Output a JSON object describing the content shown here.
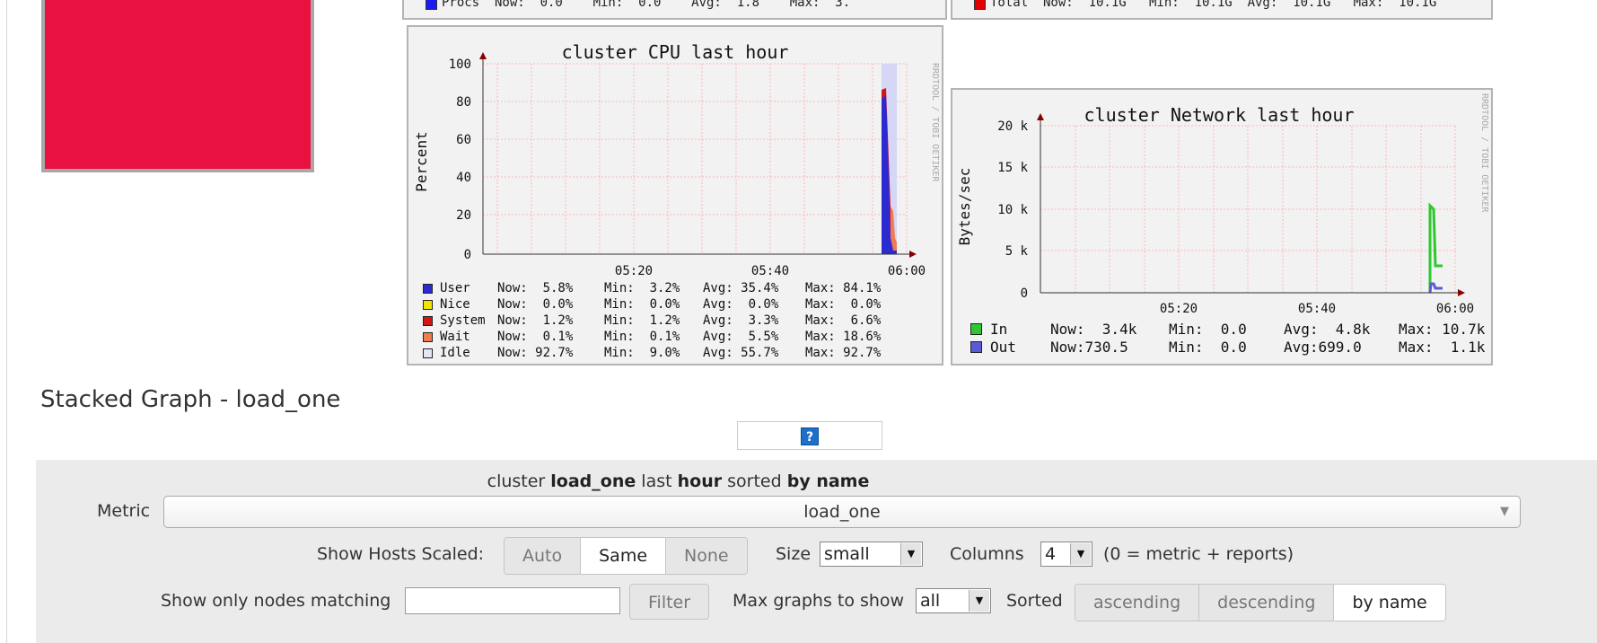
{
  "top_strip": {
    "procs_row": "Procs  Now:  0.0    Min:  0.0    Avg:  1.8    Max:  3.",
    "total_row": "Total  Now:  10.1G   Min:  10.1G  Avg:  10.1G   Max:  10.1G"
  },
  "cpu_graph": {
    "title": "cluster CPU last hour",
    "ylabel": "Percent",
    "watermark": "RRDTOOL / TOBI OETIKER",
    "y_ticks": [
      "100",
      "80",
      "60",
      "40",
      "20",
      "0"
    ],
    "x_ticks": [
      "05:20",
      "05:40",
      "06:00"
    ],
    "legend": [
      {
        "name": "User",
        "color": "#2b2bd1",
        "now": "Now:  5.8%",
        "min": "Min:  3.2%",
        "avg": "Avg: 35.4%",
        "max": "Max: 84.1%"
      },
      {
        "name": "Nice",
        "color": "#f2e600",
        "now": "Now:  0.0%",
        "min": "Min:  0.0%",
        "avg": "Avg:  0.0%",
        "max": "Max:  0.0%"
      },
      {
        "name": "System",
        "color": "#d11616",
        "now": "Now:  1.2%",
        "min": "Min:  1.2%",
        "avg": "Avg:  3.3%",
        "max": "Max:  6.6%"
      },
      {
        "name": "Wait",
        "color": "#f07b4f",
        "now": "Now:  0.1%",
        "min": "Min:  0.1%",
        "avg": "Avg:  5.5%",
        "max": "Max: 18.6%"
      },
      {
        "name": "Idle",
        "color": "#e6e6f7",
        "now": "Now: 92.7%",
        "min": "Min:  9.0%",
        "avg": "Avg: 55.7%",
        "max": "Max: 92.7%"
      }
    ]
  },
  "net_graph": {
    "title": "cluster Network last hour",
    "ylabel": "Bytes/sec",
    "watermark": "RRDTOOL / TOBI OETIKER",
    "y_ticks": [
      "20 k",
      "15 k",
      "10 k",
      "5 k",
      "0"
    ],
    "x_ticks": [
      "05:20",
      "05:40",
      "06:00"
    ],
    "legend": [
      {
        "name": "In",
        "color": "#2ec72e",
        "now": "Now:  3.4k",
        "min": "Min:  0.0",
        "avg": "Avg:  4.8k",
        "max": "Max: 10.7k"
      },
      {
        "name": "Out",
        "color": "#5a5ad6",
        "now": "Now:730.5",
        "min": "Min:  0.0",
        "avg": "Avg:699.0",
        "max": "Max:  1.1k"
      }
    ]
  },
  "section_title": "Stacked Graph - load_one",
  "help_icon_glyph": "?",
  "controls": {
    "header_parts": [
      "cluster ",
      "load_one",
      " last ",
      "hour",
      " sorted ",
      "by name"
    ],
    "metric_label": "Metric",
    "metric_value": "load_one",
    "scaled_label": "Show Hosts Scaled:",
    "scaled_options": [
      "Auto",
      "Same",
      "None"
    ],
    "scaled_selected": "Same",
    "size_label": "Size",
    "size_value": "small",
    "columns_label": "Columns",
    "columns_value": "4",
    "columns_note": "(0 = metric + reports)",
    "filter_label": "Show only nodes matching",
    "filter_value": "",
    "filter_button": "Filter",
    "max_graphs_label": "Max graphs to show",
    "max_graphs_value": "all",
    "sorted_label": "Sorted",
    "sort_options": [
      "ascending",
      "descending",
      "by name"
    ],
    "sort_selected": "by name"
  }
}
